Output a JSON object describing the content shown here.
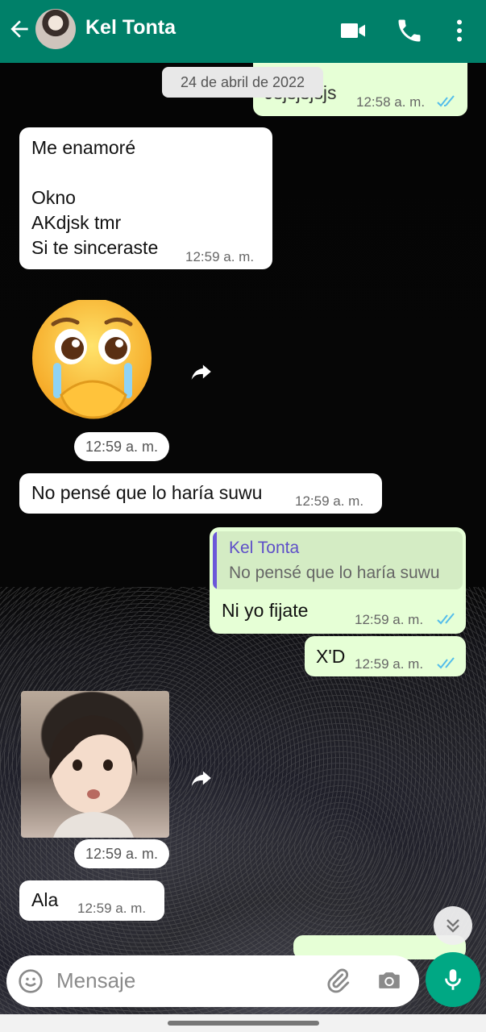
{
  "header": {
    "title": "Kel Tonta"
  },
  "date_chip": "24 de abril de 2022",
  "messages": {
    "top_partial": {
      "text": "Jsjsjsjsjs",
      "time": "12:58 a. m."
    },
    "m1": {
      "lines": [
        "Me enamoré",
        "",
        "Okno",
        "AKdjsk tmr",
        "Si te sinceraste"
      ],
      "time": "12:59 a. m."
    },
    "sticker1": {
      "time": "12:59 a. m."
    },
    "m2": {
      "text": "No pensé que lo haría suwu",
      "time": "12:59 a. m."
    },
    "reply": {
      "quote_name": "Kel Tonta",
      "quote_text": "No pensé que lo haría suwu",
      "text": "Ni yo fijate",
      "time": "12:59 a. m."
    },
    "m3": {
      "text": "X'D",
      "time": "12:59 a. m."
    },
    "sticker2": {
      "time": "12:59 a. m."
    },
    "m4": {
      "text": "Ala",
      "time": "12:59 a. m."
    }
  },
  "input": {
    "placeholder": "Mensaje"
  },
  "colors": {
    "header": "#008069",
    "outgoing": "#e6ffd6",
    "incoming": "#ffffff",
    "accent": "#00a884",
    "read_ticks": "#53bdeb"
  },
  "icons": [
    "back-arrow-icon",
    "video-call-icon",
    "phone-icon",
    "more-vert-icon",
    "forward-icon",
    "emoji-icon",
    "attach-icon",
    "camera-icon",
    "mic-icon",
    "chevron-down-icon"
  ]
}
